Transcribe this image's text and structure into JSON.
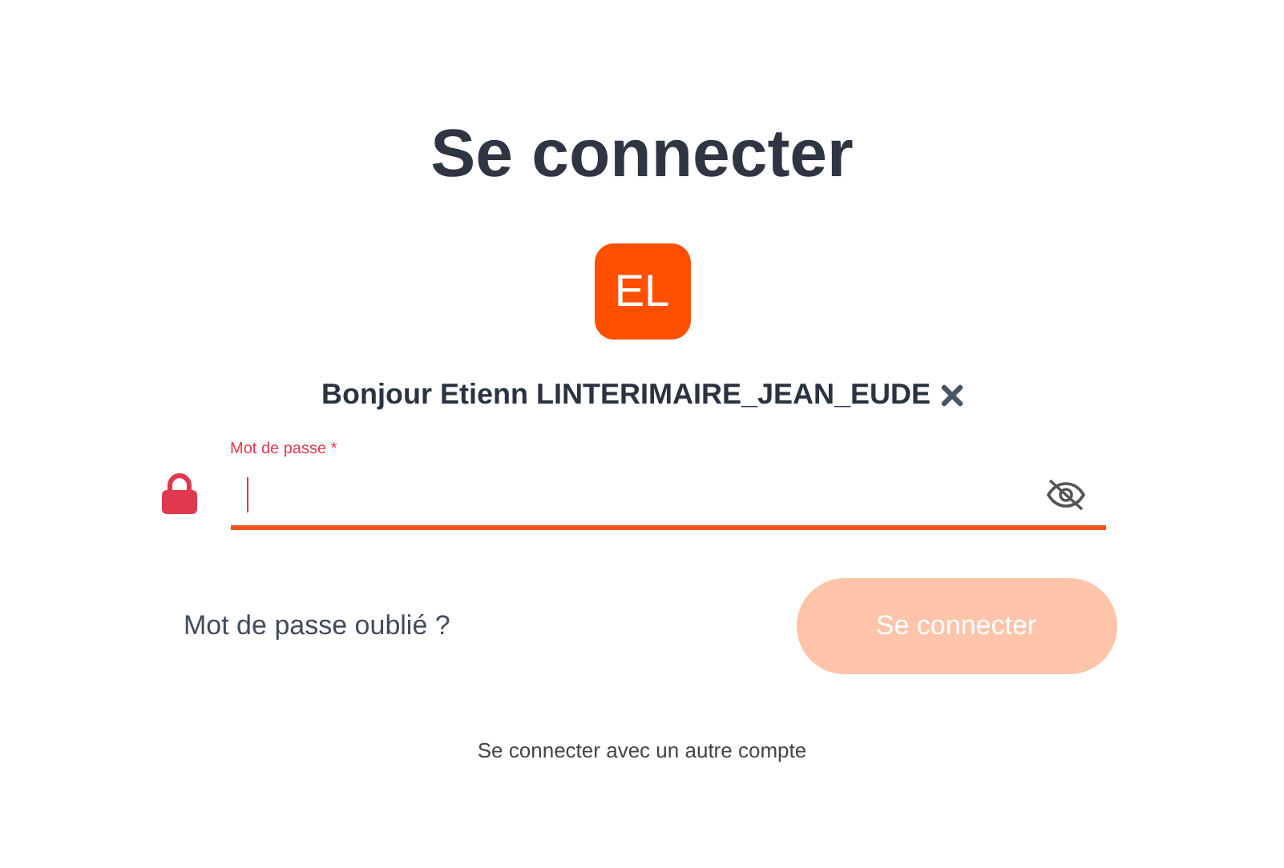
{
  "title": "Se connecter",
  "avatar": {
    "initials": "EL"
  },
  "greeting": "Bonjour Etienn LINTERIMAIRE_JEAN_EUDE",
  "password_field": {
    "label": "Mot de passe *",
    "focused": true
  },
  "forgot_link": "Mot de passe oublié ?",
  "submit_button": {
    "label": "Se connecter",
    "disabled": true
  },
  "other_account_link": "Se connecter avec un autre compte"
}
